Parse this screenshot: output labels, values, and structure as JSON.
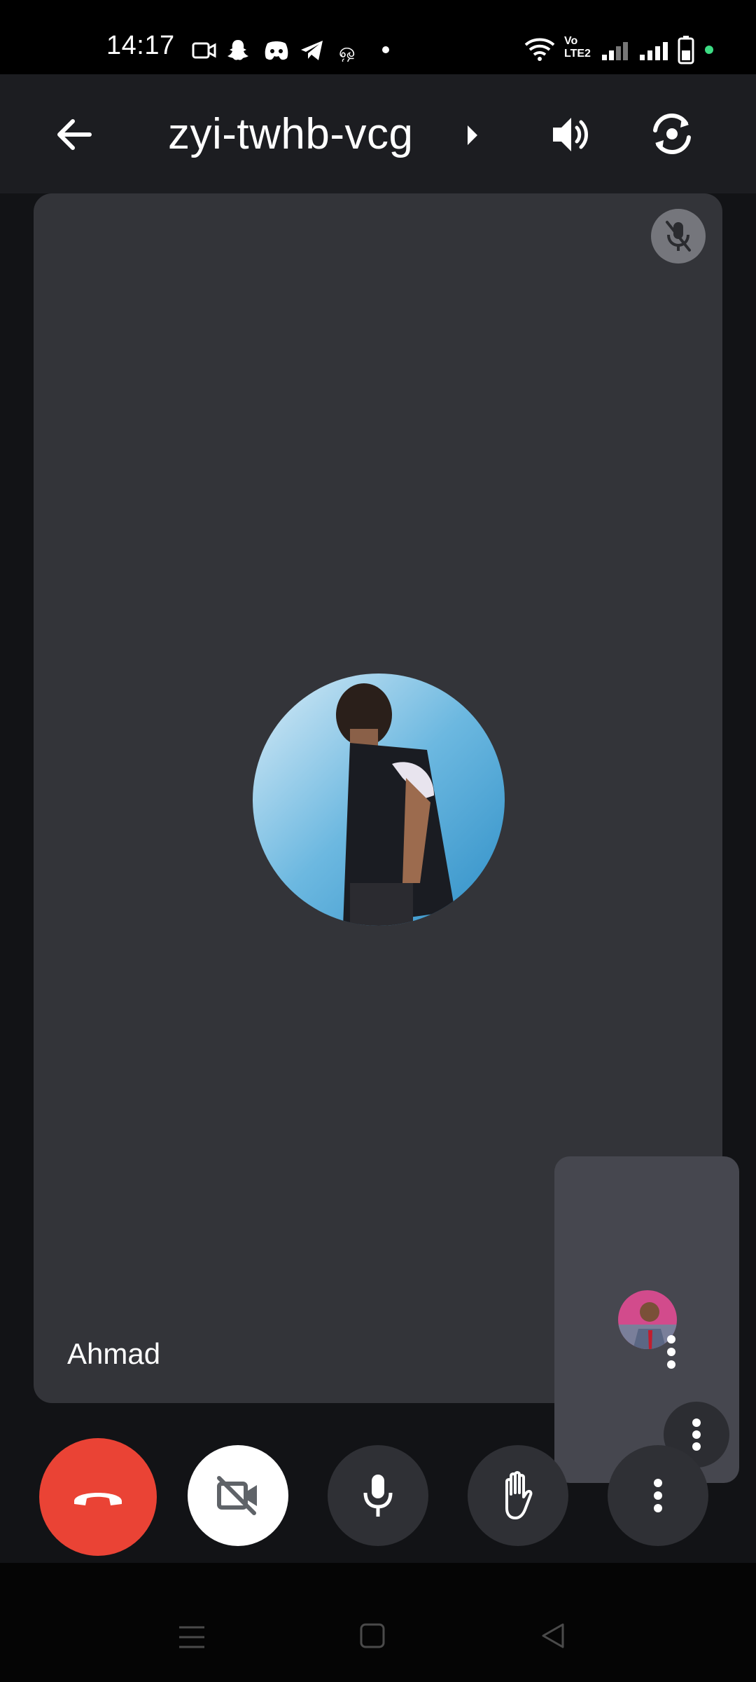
{
  "status_bar": {
    "time": "14:17",
    "notification_icons": [
      "video-camera-icon",
      "snapchat-icon",
      "discord-icon",
      "telegram-icon",
      "app-icon",
      "dot-icon"
    ],
    "right_icons": [
      "wifi-icon",
      "volte-icon",
      "signal-icon",
      "signal-icon",
      "battery-icon",
      "green-dot-icon"
    ],
    "network_label": "Vo LTE2"
  },
  "top_bar": {
    "back_icon": "arrow-left-icon",
    "meeting_code": "zyi-twhb-vcg",
    "speaker_icon": "speaker-icon",
    "switch_camera_icon": "switch-camera-icon"
  },
  "main_tile": {
    "participant_name": "Ahmad",
    "muted_icon": "mic-off-icon",
    "background_color": "#333439"
  },
  "self_tile": {
    "more_icon": "more-vert-icon"
  },
  "controls": {
    "end_call_color": "#ea4335",
    "items": [
      "end-call-button",
      "camera-off-button",
      "mic-button",
      "raise-hand-button",
      "more-options-button"
    ]
  },
  "nav_bar": {
    "items": [
      "recents-icon",
      "home-icon",
      "back-icon"
    ]
  }
}
